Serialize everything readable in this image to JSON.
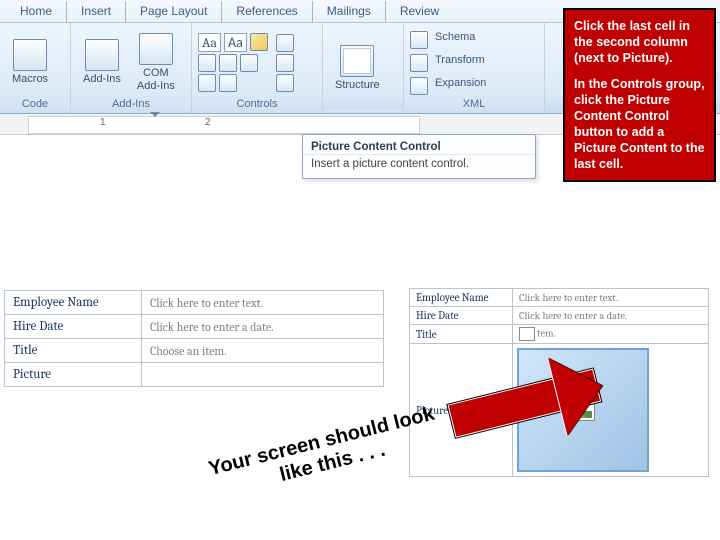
{
  "tabs": [
    "Home",
    "Insert",
    "Page Layout",
    "References",
    "Mailings",
    "Review"
  ],
  "groups": [
    {
      "label": "Code",
      "buttons": [
        {
          "label": "Macros"
        }
      ]
    },
    {
      "label": "Add-Ins",
      "buttons": [
        {
          "label": "Add-Ins"
        },
        {
          "label": "COM\nAdd-Ins"
        }
      ]
    },
    {
      "label": "Controls",
      "font_row": [
        "Aa",
        "Aa"
      ]
    },
    {
      "label": "",
      "buttons": [
        {
          "label": "Structure"
        }
      ]
    },
    {
      "label": "XML",
      "items": [
        "Schema",
        "Transform",
        "Expansion"
      ]
    }
  ],
  "ruler": {
    "nums": [
      "1",
      "2"
    ]
  },
  "tooltip": {
    "title": "Picture Content Control",
    "body": "Insert a picture content control."
  },
  "callout": {
    "p1": "Click the last cell in the second column (next to Picture).",
    "p2": "In the Controls group, click the Picture Content Control button  to add a Picture Content to the last cell."
  },
  "table_before": {
    "rows": [
      [
        "Employee Name",
        "Click here to enter text."
      ],
      [
        "Hire Date",
        "Click here to enter a date."
      ],
      [
        "Title",
        "Choose an item."
      ],
      [
        "Picture",
        ""
      ]
    ]
  },
  "table_after": {
    "rows": [
      [
        "Employee Name",
        "Click here to enter text."
      ],
      [
        "Hire Date",
        "Click here to enter a date."
      ],
      [
        "Title",
        "tem."
      ],
      [
        "Picture",
        "[pic]"
      ]
    ]
  },
  "annotation": "Your screen should look \n like this . . ."
}
